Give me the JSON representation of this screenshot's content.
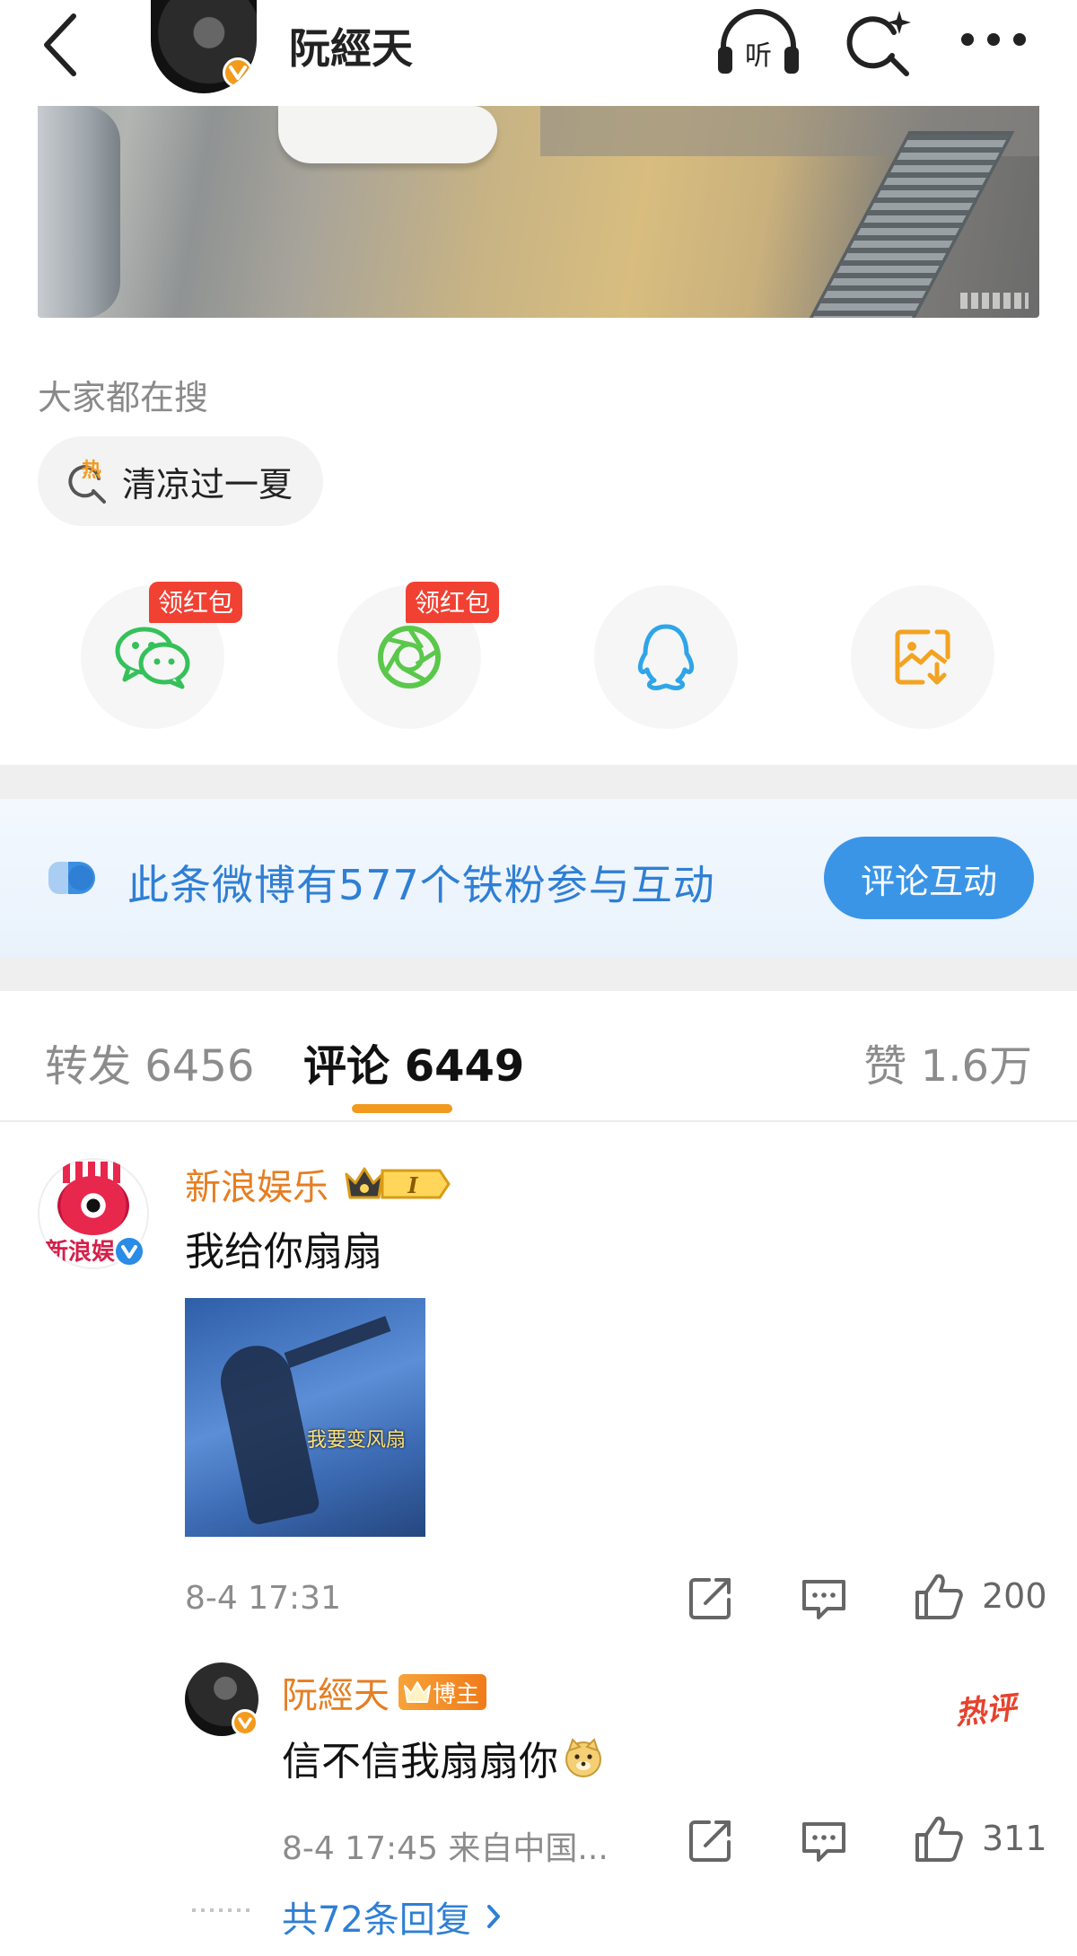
{
  "header": {
    "title": "阮經天",
    "listen_label": "听"
  },
  "search_section": {
    "title": "大家都在搜",
    "chip_label": "清凉过一夏",
    "hot_glyph": "热"
  },
  "share": {
    "red_tag": "领红包",
    "items": [
      "wechat",
      "moments",
      "qq",
      "save-image"
    ]
  },
  "fans_banner": {
    "text": "此条微博有577个铁粉参与互动",
    "button": "评论互动"
  },
  "tabs": {
    "repost": "转发 6456",
    "comments": "评论 6449",
    "likes": "赞 1.6万"
  },
  "comments": [
    {
      "user": "新浪娱乐",
      "avatar_text": "新浪娱",
      "level_badge": "I",
      "text": "我给你扇扇",
      "image_caption": "我要变风扇",
      "time": "8-4 17:31",
      "likes": "200",
      "reply": {
        "user": "阮經天",
        "badge": "博主",
        "text": "信不信我扇扇你",
        "time_source": "8-4 17:45  来自中国...",
        "likes": "311",
        "hot_tag": "热评"
      },
      "replies_link": "共72条回复"
    }
  ],
  "colors": {
    "accent_orange": "#f19a1d",
    "link_blue": "#2f7fd4",
    "button_blue": "#3b95e7",
    "red_tag": "#f14133"
  }
}
